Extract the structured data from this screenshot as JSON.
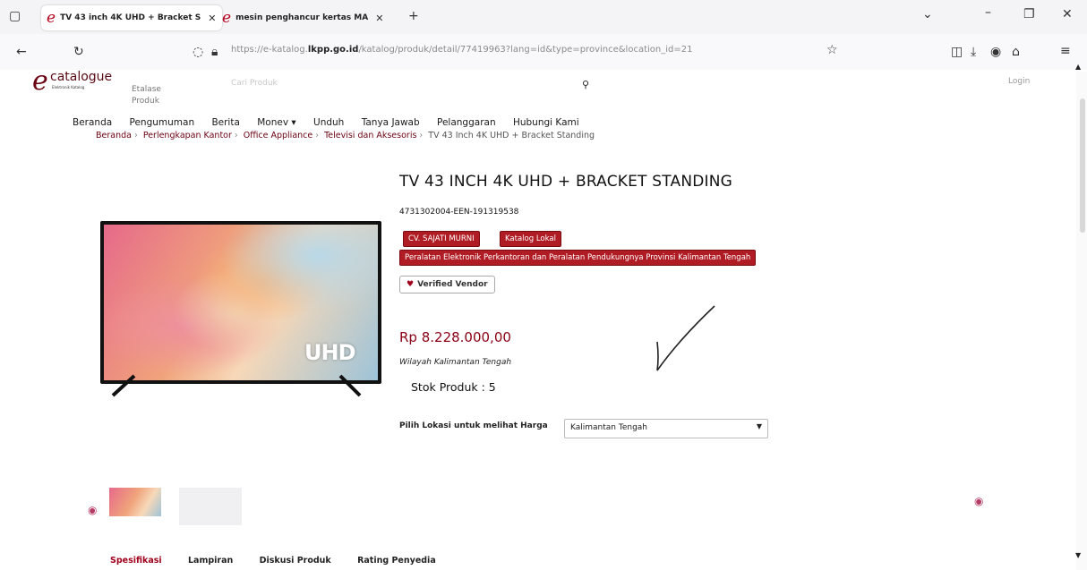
{
  "browser": {
    "tabs": [
      {
        "title": "TV 43 inch 4K UHD + Bracket S",
        "active": true
      },
      {
        "title": "mesin penghancur kertas MA",
        "active": false
      }
    ],
    "new_tab": "+",
    "url": {
      "prefix": "https://e-katalog.",
      "domain": "lkpp.go.id",
      "path": "/katalog/produk/detail/77419963?lang=id&type=province&location_id=21"
    }
  },
  "header": {
    "logo_e": "e",
    "logo_text": "catalogue",
    "logo_sub": "Elektronik Katalog",
    "etalase": [
      "Etalase",
      "Produk"
    ],
    "search_placeholder": "Cari Produk",
    "login": "Login"
  },
  "nav": [
    "Beranda",
    "Pengumuman",
    "Berita",
    "Monev ▾",
    "Unduh",
    "Tanya Jawab",
    "Pelanggaran",
    "Hubungi Kami"
  ],
  "breadcrumb": [
    "Beranda",
    "Perlengkapan Kantor",
    "Office Appliance",
    "Televisi dan Aksesoris",
    "TV 43 Inch 4K UHD + Bracket Standing"
  ],
  "product": {
    "title": "TV 43 INCH 4K UHD + BRACKET STANDING",
    "code": "4731302004-EEN-191319538",
    "vendor_badge": "CV. SAJATI MURNI",
    "katalog_badge": "Katalog Lokal",
    "category_badge": "Peralatan Elektronik Perkantoran dan Peralatan Pendukungnya Provinsi Kalimantan Tengah",
    "verified": "Verified Vendor",
    "price": "Rp 8.228.000,00",
    "wilayah": "Wilayah Kalimantan Tengah",
    "stok_label": "Stok Produk :",
    "stok_value": "5",
    "location_label": "Pilih Lokasi untuk melihat Harga",
    "location_value": "Kalimantan Tengah",
    "tv_label": "UHD"
  },
  "detail_tabs": [
    "Spesifikasi",
    "Lampiran",
    "Diskusi Produk",
    "Rating Penyedia"
  ]
}
